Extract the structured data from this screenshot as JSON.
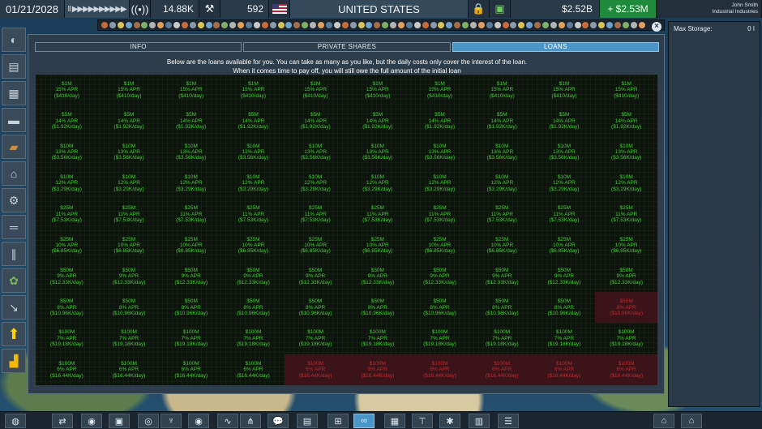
{
  "topbar": {
    "date": "01/21/2028",
    "speed_controls": "II ▶▶▶▶▶▶▶▶▶▶",
    "population": "14.88K",
    "workers": "592",
    "country": "UNITED STATES",
    "money": "$2.52B",
    "income": "+ $2.53M",
    "player_name": "John Smith",
    "company_name": "Industrial Industries"
  },
  "right_panel": {
    "label": "Max Storage:",
    "value": "0 I"
  },
  "modal": {
    "tabs": [
      "INFO",
      "PRIVATE SHARES",
      "LOANS"
    ],
    "active_tab": "LOANS",
    "intro_line1": "Below are the loans available for you. You can take as many as you like, but the daily costs only cover the interest of the loan.",
    "intro_line2": "When it comes time to pay off, you will still owe the full amount of the initial loan",
    "close_label": "×"
  },
  "colors": {
    "available_text": "#3fce2e",
    "unavailable_text": "#c0282f",
    "unavailable_bg": "#3a1418",
    "active_tab": "#4a96c9"
  },
  "loan_tiers": [
    {
      "amount": "$1M",
      "apr": "15% APR",
      "cost": "($410/day)",
      "available": [
        true,
        true,
        true,
        true,
        true,
        true,
        true,
        true,
        true,
        true
      ]
    },
    {
      "amount": "$5M",
      "apr": "14% APR",
      "cost": "($1.92K/day)",
      "available": [
        true,
        true,
        true,
        true,
        true,
        true,
        true,
        true,
        true,
        true
      ]
    },
    {
      "amount": "$10M",
      "apr": "13% APR",
      "cost": "($3.56K/day)",
      "available": [
        true,
        true,
        true,
        true,
        true,
        true,
        true,
        true,
        true,
        true
      ]
    },
    {
      "amount": "$10M",
      "apr": "12% APR",
      "cost": "($3.29K/day)",
      "available": [
        true,
        true,
        true,
        true,
        true,
        true,
        true,
        true,
        true,
        true
      ]
    },
    {
      "amount": "$25M",
      "apr": "11% APR",
      "cost": "($7.53K/day)",
      "available": [
        true,
        true,
        true,
        true,
        true,
        true,
        true,
        true,
        true,
        true
      ]
    },
    {
      "amount": "$25M",
      "apr": "10% APR",
      "cost": "($6.85K/day)",
      "available": [
        true,
        true,
        true,
        true,
        true,
        true,
        true,
        true,
        true,
        true
      ]
    },
    {
      "amount": "$50M",
      "apr": "9% APR",
      "cost": "($12.33K/day)",
      "available": [
        true,
        true,
        true,
        true,
        true,
        true,
        true,
        true,
        true,
        true
      ]
    },
    {
      "amount": "$50M",
      "apr": "8% APR",
      "cost": "($10.96K/day)",
      "available": [
        true,
        true,
        true,
        true,
        true,
        true,
        true,
        true,
        true,
        false
      ]
    },
    {
      "amount": "$100M",
      "apr": "7% APR",
      "cost": "($19.18K/day)",
      "available": [
        true,
        true,
        true,
        true,
        true,
        true,
        true,
        true,
        true,
        true
      ]
    },
    {
      "amount": "$100M",
      "apr": "6% APR",
      "cost": "($16.44K/day)",
      "available": [
        true,
        true,
        true,
        true,
        false,
        false,
        false,
        false,
        false,
        false
      ]
    }
  ],
  "left_sidebar": [
    "globe-icon",
    "rail-icon",
    "warehouse-icon",
    "tank-icon",
    "truck-icon",
    "crane-icon",
    "factory-icon",
    "pipe-icon",
    "silo-icon",
    "farm-icon",
    "shovel-icon",
    "upgrade-arrow-icon",
    "bulldozer-icon"
  ],
  "bottom_bar": [
    "world-icon",
    "route-icon",
    "eye-icon",
    "train-icon",
    "view-icon",
    "pylon-icon",
    "eye-small-icon",
    "route-map-icon",
    "network-icon",
    "chat-icon",
    "factory-toggle-icon",
    "basket-icon",
    "handshake-icon",
    "document-icon",
    "crane-toggle-icon",
    "settings-icon",
    "book-icon",
    "report-icon",
    "list-icon",
    "home-icon"
  ]
}
